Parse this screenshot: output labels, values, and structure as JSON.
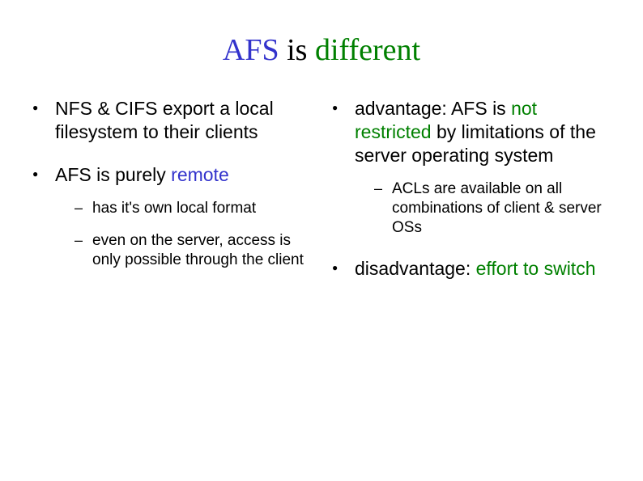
{
  "slide": {
    "title": {
      "segments": [
        {
          "text": "AFS",
          "color": "blue"
        },
        {
          "text": " is ",
          "color": "black"
        },
        {
          "text": "different",
          "color": "green"
        }
      ]
    },
    "left": {
      "items": [
        {
          "segments": [
            {
              "text": "NFS & CIFS export a local filesystem to their clients",
              "color": "black"
            }
          ]
        },
        {
          "segments": [
            {
              "text": "AFS is purely ",
              "color": "black"
            },
            {
              "text": "remote",
              "color": "blue"
            }
          ],
          "sub": [
            {
              "segments": [
                {
                  "text": "has it's own local format",
                  "color": "black"
                }
              ]
            },
            {
              "segments": [
                {
                  "text": "even on the server, access is only possible through the client",
                  "color": "black"
                }
              ]
            }
          ]
        }
      ]
    },
    "right": {
      "items": [
        {
          "segments": [
            {
              "text": "advantage: AFS is ",
              "color": "black"
            },
            {
              "text": "not restricted",
              "color": "green"
            },
            {
              "text": " by limitations of the server operating system",
              "color": "black"
            }
          ],
          "sub": [
            {
              "segments": [
                {
                  "text": "ACLs are available on all combinations of client & server OSs",
                  "color": "black"
                }
              ]
            }
          ]
        },
        {
          "segments": [
            {
              "text": "disadvantage: ",
              "color": "black"
            },
            {
              "text": "effort to switch",
              "color": "green"
            }
          ]
        }
      ]
    }
  }
}
